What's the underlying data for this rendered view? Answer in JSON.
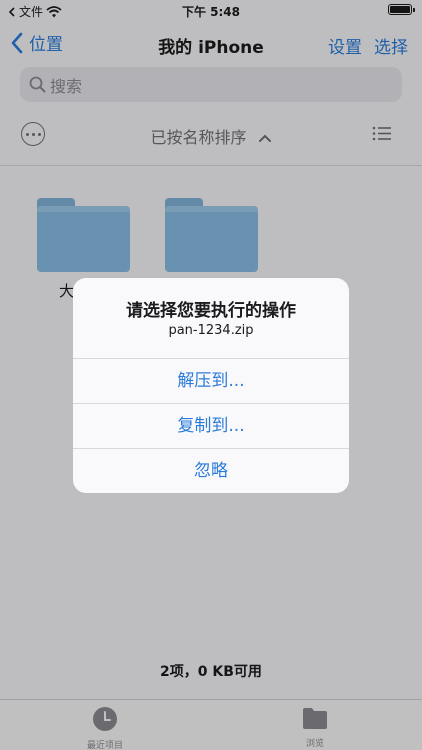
{
  "status": {
    "carrier": "文件",
    "time": "下午 5:48"
  },
  "nav": {
    "back": "位置",
    "title": "我的 iPhone",
    "settings": "设置",
    "select": "选择"
  },
  "search": {
    "placeholder": "搜索"
  },
  "toolbar": {
    "sort_label": "已按名称排序"
  },
  "folders": [
    {
      "label": "大"
    },
    {
      "label": ""
    }
  ],
  "footer": {
    "summary": "2项，0 KB可用"
  },
  "tabs": [
    {
      "label": "最近项目"
    },
    {
      "label": "浏览"
    }
  ],
  "alert": {
    "title": "请选择您要执行的操作",
    "message": "pan-1234.zip",
    "actions": [
      {
        "label": "解压到..."
      },
      {
        "label": "复制到..."
      },
      {
        "label": "忽略"
      }
    ]
  },
  "colors": {
    "accent": "#2a7bd9",
    "folder": "#86bce0"
  }
}
